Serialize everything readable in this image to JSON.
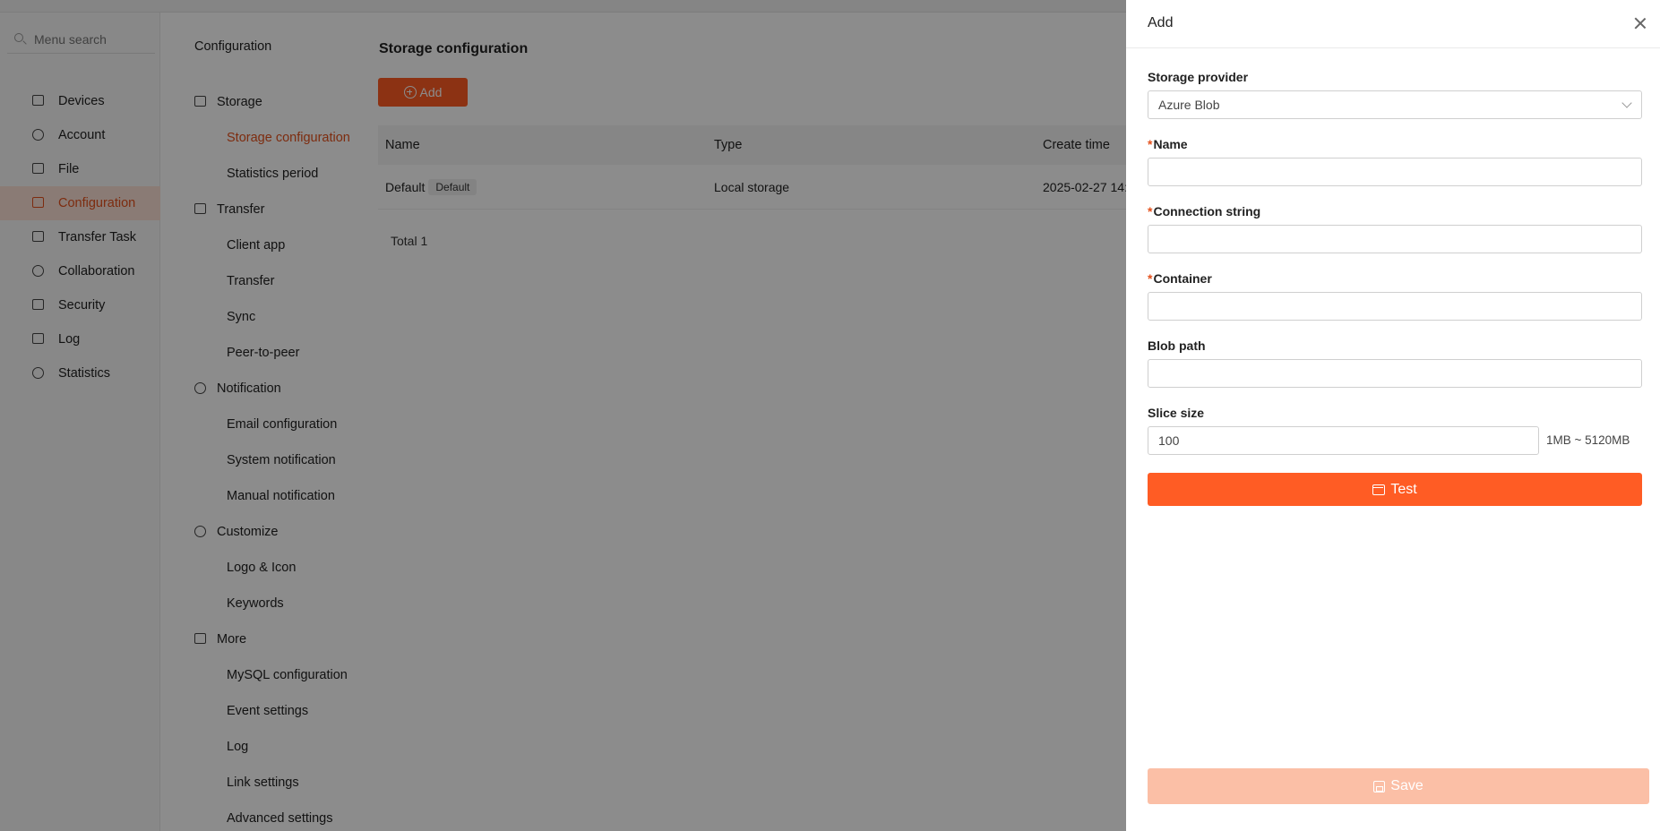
{
  "search": {
    "placeholder": "Menu search"
  },
  "sidebar": {
    "items": [
      {
        "label": "Devices",
        "icon": "chart-icon"
      },
      {
        "label": "Account",
        "icon": "user-icon"
      },
      {
        "label": "File",
        "icon": "file-icon"
      },
      {
        "label": "Configuration",
        "icon": "sliders-icon",
        "active": true
      },
      {
        "label": "Transfer Task",
        "icon": "transfer-icon"
      },
      {
        "label": "Collaboration",
        "icon": "collaboration-icon"
      },
      {
        "label": "Security",
        "icon": "shield-icon"
      },
      {
        "label": "Log",
        "icon": "log-icon"
      },
      {
        "label": "Statistics",
        "icon": "pie-chart-icon"
      }
    ]
  },
  "config_panel": {
    "title": "Configuration",
    "groups": [
      {
        "label": "Storage",
        "icon": "storage-icon",
        "items": [
          "Storage configuration",
          "Statistics period"
        ]
      },
      {
        "label": "Transfer",
        "icon": "transfer-icon",
        "items": [
          "Client app",
          "Transfer",
          "Sync",
          "Peer-to-peer"
        ]
      },
      {
        "label": "Notification",
        "icon": "bell-icon",
        "items": [
          "Email configuration",
          "System notification",
          "Manual notification"
        ]
      },
      {
        "label": "Customize",
        "icon": "customize-icon",
        "items": [
          "Logo & Icon",
          "Keywords"
        ]
      },
      {
        "label": "More",
        "icon": "grid-icon",
        "items": [
          "MySQL configuration",
          "Event settings",
          "Log",
          "Link settings",
          "Advanced settings"
        ]
      }
    ],
    "active_item": "Storage configuration"
  },
  "main": {
    "title": "Storage configuration",
    "add_label": "Add",
    "table": {
      "headers": [
        "Name",
        "Type",
        "Create time"
      ],
      "rows": [
        {
          "name": "Default",
          "tag": "Default",
          "type": "Local storage",
          "create_time": "2025-02-27 14:"
        }
      ]
    },
    "total": "Total 1"
  },
  "drawer": {
    "title": "Add",
    "storage_provider": {
      "label": "Storage provider",
      "value": "Azure Blob"
    },
    "name": {
      "label": "Name",
      "value": ""
    },
    "connection_string": {
      "label": "Connection string",
      "value": ""
    },
    "container": {
      "label": "Container",
      "value": ""
    },
    "blob_path": {
      "label": "Blob path",
      "value": ""
    },
    "slice_size": {
      "label": "Slice size",
      "value": "100",
      "hint": "1MB ~ 5120MB"
    },
    "required_mark": "*",
    "test_label": "Test",
    "save_label": "Save"
  },
  "colors": {
    "accent": "#ff5c24",
    "accent_disabled": "#fbbfa6",
    "active_bg": "#fbe1d6"
  }
}
